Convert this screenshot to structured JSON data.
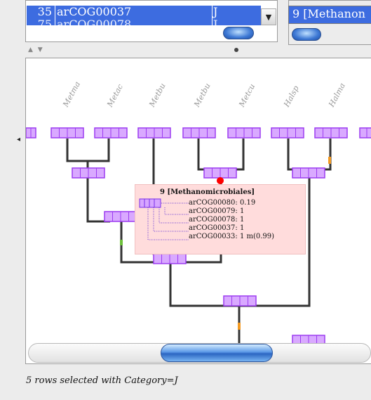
{
  "table": {
    "rows": [
      {
        "num": "35",
        "name": "arCOG00037",
        "category": "J"
      },
      {
        "num": "75",
        "name": "arCOG00078",
        "category": "J"
      }
    ]
  },
  "select": {
    "value": "9 [Methanon"
  },
  "icons": {
    "dropdown": "triangle-down-icon",
    "splitter": "splitter-arrows-icon"
  },
  "splitter": {
    "arrows": "▲ ▼"
  },
  "tree": {
    "leaf_labels": [
      "Metma",
      "Metac",
      "Metbu",
      "Metbu",
      "Metcu",
      "Halsp",
      "Halma"
    ],
    "accent_color": "#9c3cf0",
    "selected_node_color": "#ff0000"
  },
  "tooltip": {
    "title": "9 [Methanomicrobiales]",
    "lines": [
      "arCOG00080: 0.19",
      "arCOG00079: 1",
      "arCOG00078: 1",
      "arCOG00037: 1",
      "arCOG00033: 1 m(0.99)"
    ]
  },
  "status": "5 rows selected with Category=J"
}
